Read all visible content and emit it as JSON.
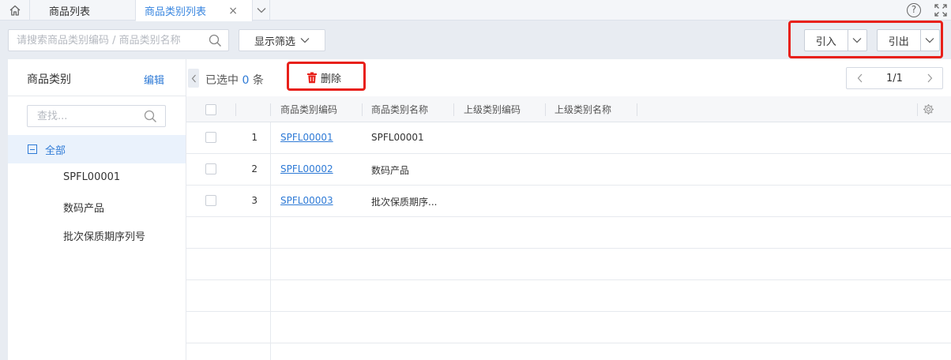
{
  "tabs": {
    "home_icon": "home-icon",
    "items": [
      {
        "label": "商品列表"
      },
      {
        "label": "商品类别列表",
        "close": "×"
      }
    ],
    "help": "?"
  },
  "toolbar": {
    "search_placeholder": "请搜索商品类别编码 / 商品类别名称",
    "filter_label": "显示筛选",
    "import_label": "引入",
    "export_label": "引出"
  },
  "left_panel": {
    "title": "商品类别",
    "edit": "编辑",
    "search_placeholder": "查找...",
    "root": "全部",
    "items": [
      "SPFL00001",
      "数码产品",
      "批次保质期序列号"
    ]
  },
  "main": {
    "selected_prefix": "已选中",
    "selected_count": "0",
    "selected_suffix": "条",
    "delete_label": "删除",
    "pager": "1/1",
    "columns": [
      "商品类别编码",
      "商品类别名称",
      "上级类别编码",
      "上级类别名称"
    ],
    "rows": [
      {
        "index": "1",
        "code": "SPFL00001",
        "name": "SPFL00001"
      },
      {
        "index": "2",
        "code": "SPFL00002",
        "name": "数码产品"
      },
      {
        "index": "3",
        "code": "SPFL00003",
        "name": "批次保质期序..."
      }
    ]
  },
  "colors": {
    "accent": "#2e7ad6",
    "highlight": "#e8201a",
    "delete_icon": "#e8201a"
  }
}
